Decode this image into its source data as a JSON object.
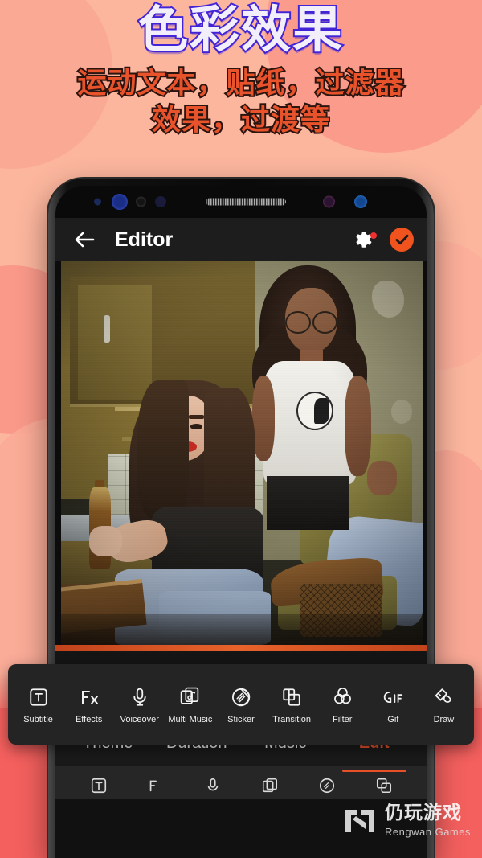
{
  "promo": {
    "headline": "色彩效果",
    "subheadline_line1": "运动文本，贴纸，过滤器",
    "subheadline_line2": "效果，过渡等",
    "headline_fill": "#F2EFFB",
    "headline_stroke": "#4224D8",
    "sub_fill": "#E8532B",
    "sub_stroke": "#2A1410",
    "background_color": "#FCB69E",
    "background_accent": "#F4605E"
  },
  "app": {
    "appbar": {
      "back_icon": "arrow-left-icon",
      "title": "Editor",
      "settings_icon": "gear-icon",
      "settings_badge": "•",
      "confirm_icon": "check-icon",
      "confirm_color": "#F0531E"
    },
    "status": {
      "sensor_icons": [
        "proximity-sensor",
        "front-camera",
        "iris-sensor",
        "light-sensor",
        "earpiece-speaker",
        "led-indicator",
        "status-dot"
      ]
    },
    "toolbar": {
      "items": [
        {
          "label": "Subtitle",
          "icon": "subtitle-icon"
        },
        {
          "label": "Effects",
          "icon": "effects-fx-icon"
        },
        {
          "label": "Voiceover",
          "icon": "microphone-icon"
        },
        {
          "label": "Multi Music",
          "icon": "multi-music-icon"
        },
        {
          "label": "Sticker",
          "icon": "sticker-icon"
        },
        {
          "label": "Transition",
          "icon": "transition-icon"
        },
        {
          "label": "Filter",
          "icon": "filter-circles-icon"
        },
        {
          "label": "Gif",
          "icon": "gif-icon"
        },
        {
          "label": "Draw",
          "icon": "draw-brush-icon"
        }
      ]
    },
    "tabs": {
      "items": [
        {
          "label": "Theme",
          "active": false
        },
        {
          "label": "Duration",
          "active": false
        },
        {
          "label": "Music",
          "active": false
        },
        {
          "label": "Edit",
          "active": true
        }
      ],
      "active_color": "#E8502A"
    },
    "preview": {
      "description": "Photo of two women in a vintage kitchen, one seated holding a bottle, one standing behind an armchair"
    }
  },
  "watermark": {
    "logo_icon": "rengwan-logo-icon",
    "cn_text": "仍玩游戏",
    "en_text": "Rengwan Games"
  }
}
